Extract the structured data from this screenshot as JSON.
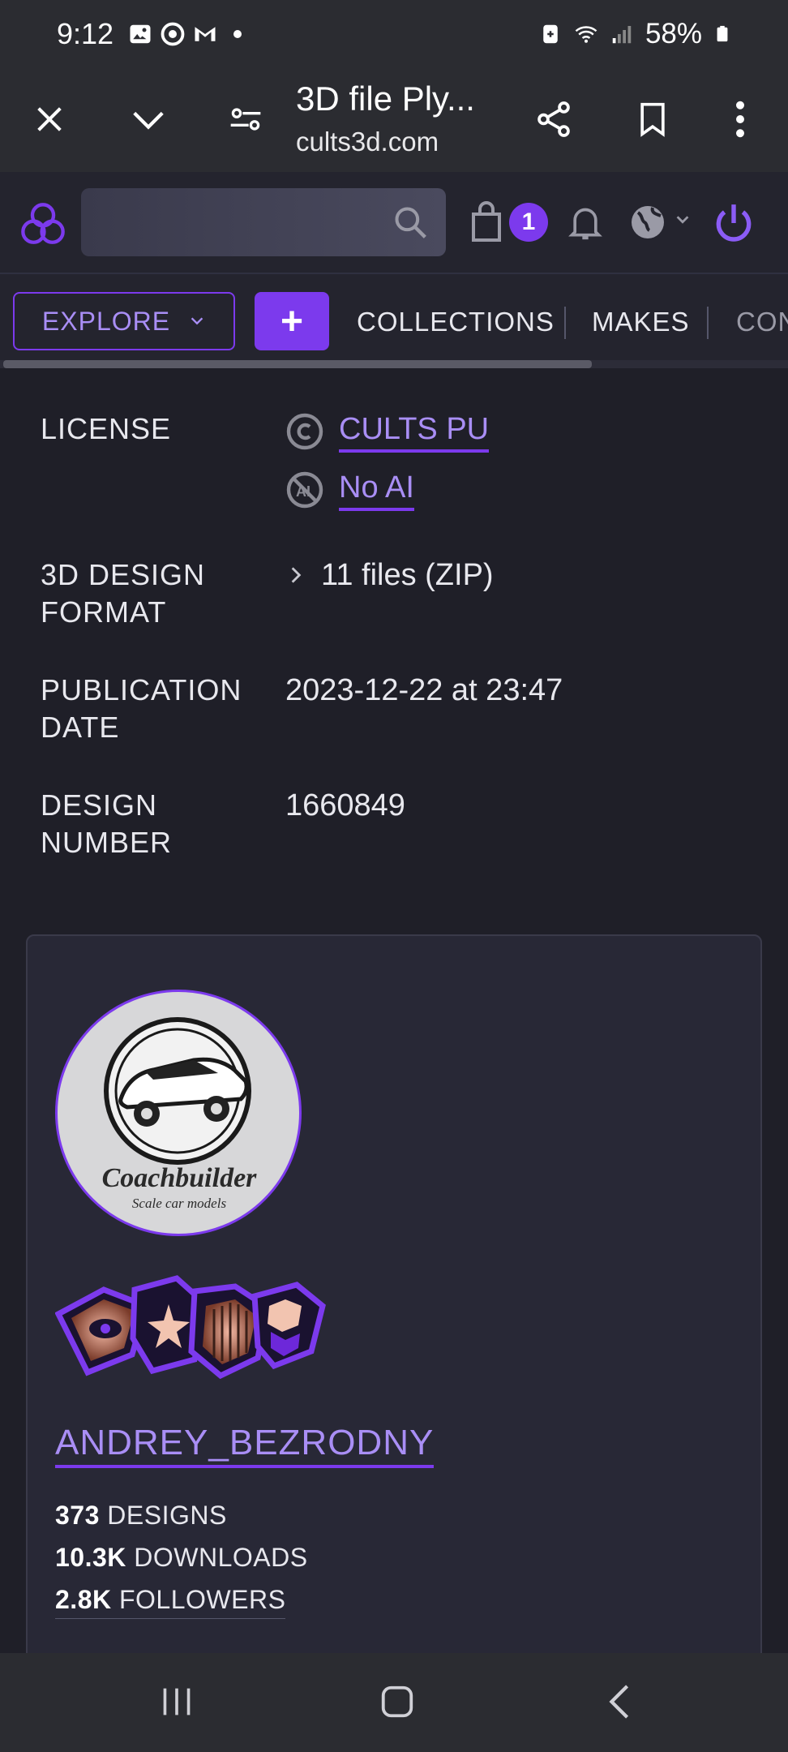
{
  "status_bar": {
    "time": "9:12",
    "battery": "58%"
  },
  "browser": {
    "title": "3D file Ply...",
    "url": "cults3d.com"
  },
  "header": {
    "cart_count": "1"
  },
  "nav": {
    "explore_label": "EXPLORE",
    "plus_label": "+",
    "links": [
      "COLLECTIONS",
      "MAKES",
      "CON"
    ]
  },
  "details": {
    "license_label": "LICENSE",
    "license_links": [
      "CULTS PU",
      "No AI"
    ],
    "format_label_1": "3D DESIGN",
    "format_label_2": "FORMAT",
    "format_value": "11 files (ZIP)",
    "pubdate_label_1": "PUBLICATION",
    "pubdate_label_2": "DATE",
    "pubdate_value": "2023-12-22 at 23:47",
    "number_label_1": "DESIGN",
    "number_label_2": "NUMBER",
    "number_value": "1660849"
  },
  "designer": {
    "avatar_text": "Coachbuilder",
    "avatar_subtext": "Scale car models",
    "username": "ANDREY_BEZRODNY",
    "designs_count": "373",
    "designs_label": "DESIGNS",
    "downloads_count": "10.3K",
    "downloads_label": "DOWNLOADS",
    "followers_count": "2.8K",
    "followers_label": "FOLLOWERS"
  },
  "colors": {
    "accent": "#7c3aed",
    "link": "#a98ef5",
    "background": "#1f1f28"
  }
}
